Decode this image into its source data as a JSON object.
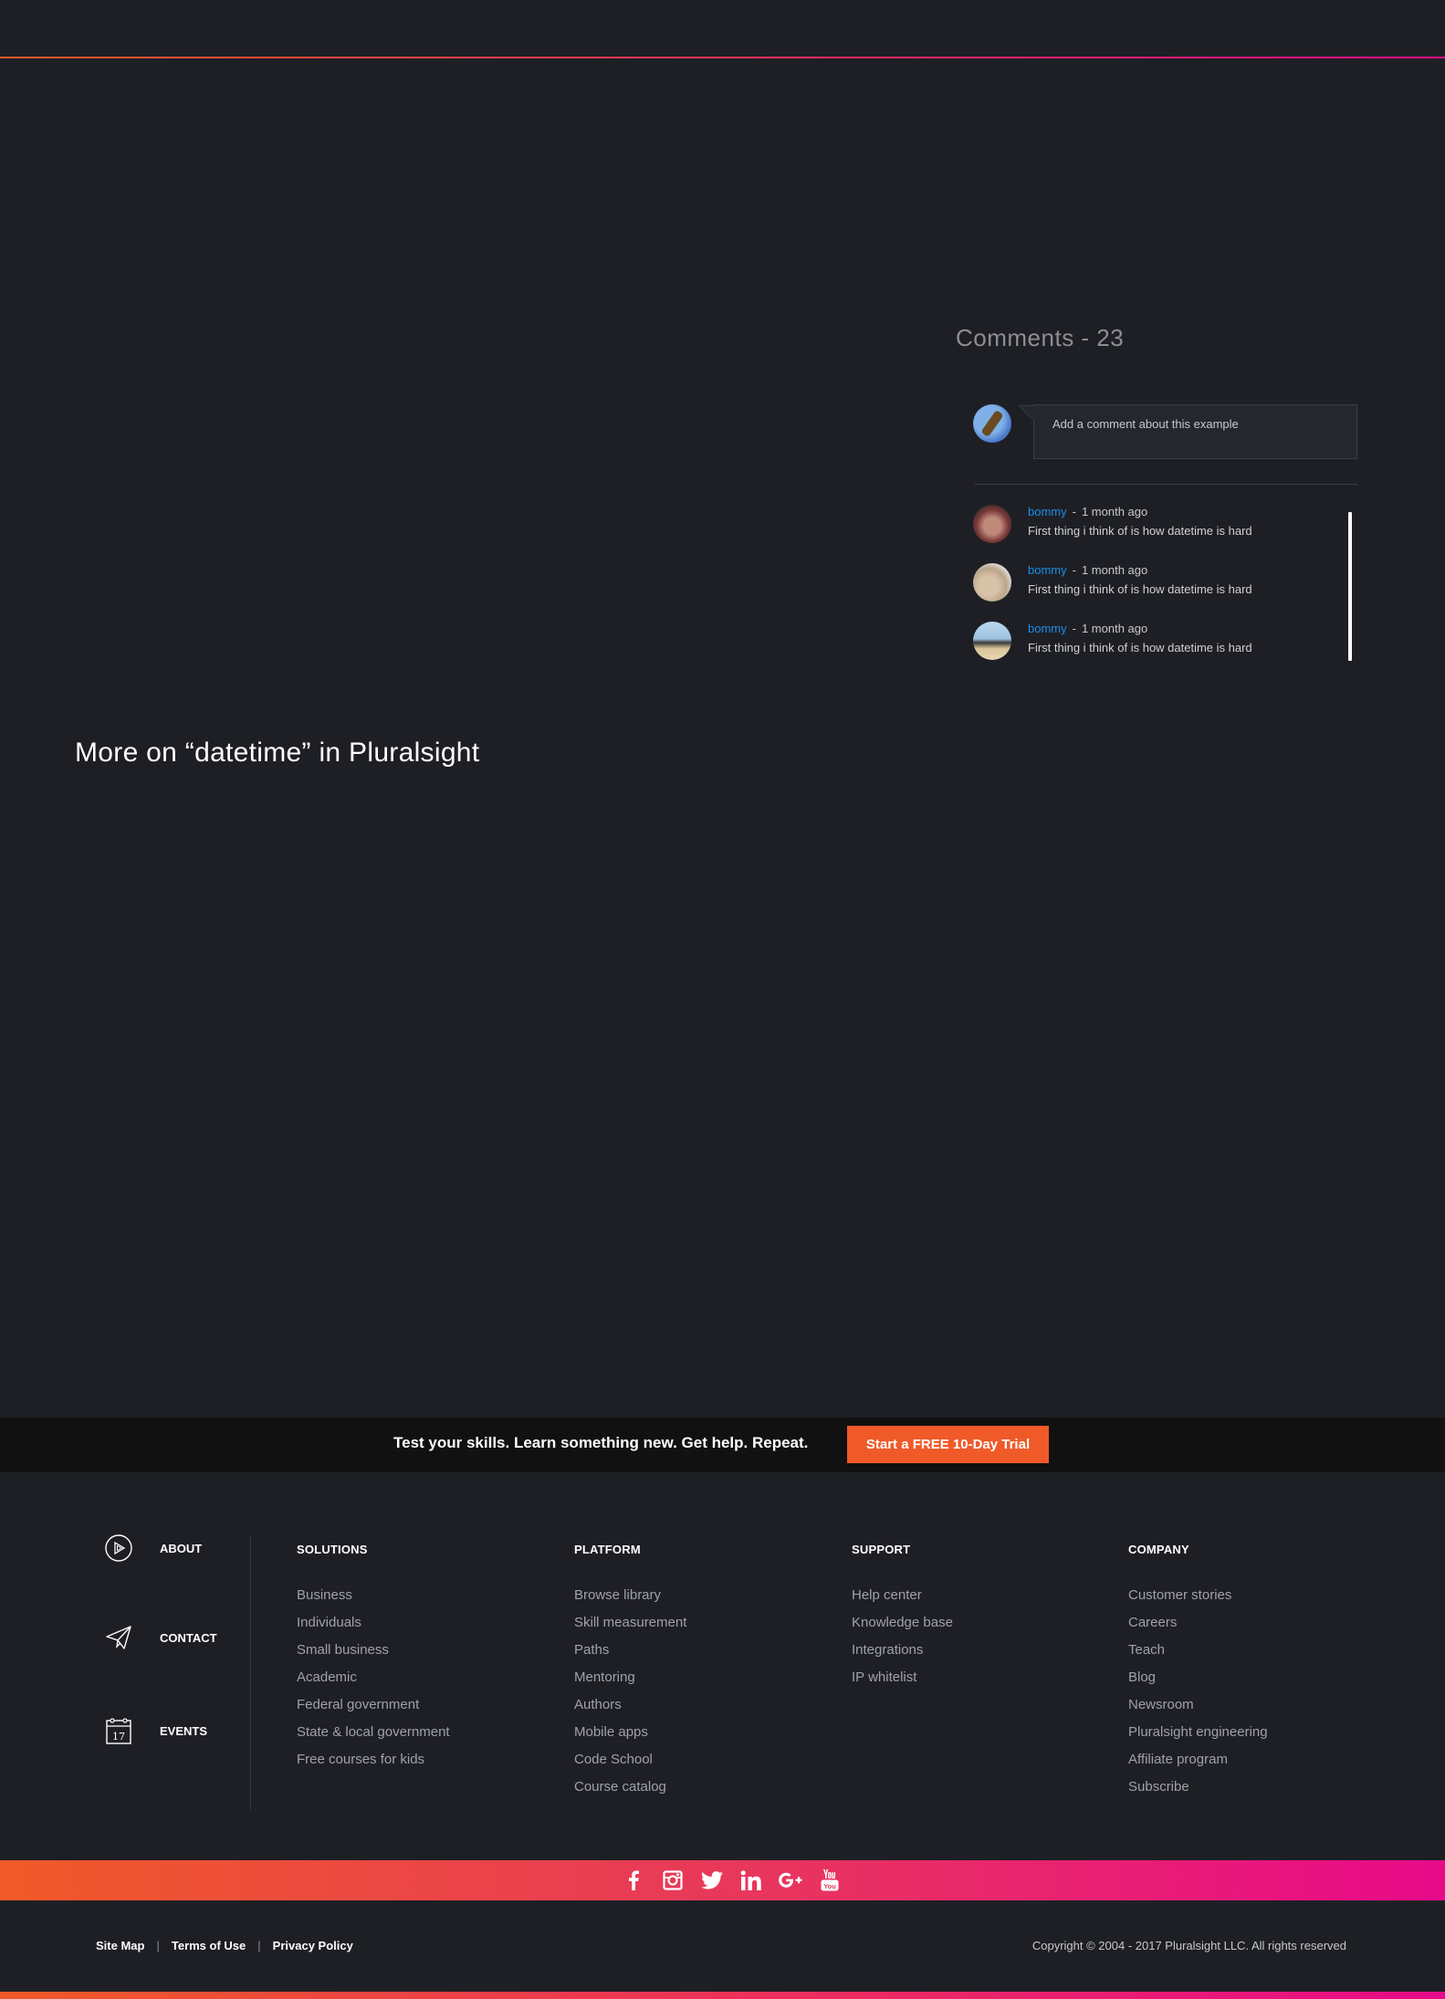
{
  "comments": {
    "title": "Comments - 23",
    "input_placeholder": "Add a comment about this example",
    "items": [
      {
        "author": "bommy",
        "separator": "-",
        "time": "1 month ago",
        "text": "First thing i think of is how datetime is hard"
      },
      {
        "author": "bommy",
        "separator": "-",
        "time": "1 month ago",
        "text": "First thing i think of is how datetime is hard"
      },
      {
        "author": "bommy",
        "separator": "-",
        "time": "1 month ago",
        "text": "First thing i think of is how datetime is hard"
      }
    ]
  },
  "more_heading": "More on “datetime” in Pluralsight",
  "cta": {
    "text": "Test your skills. Learn something new. Get help. Repeat.",
    "button": "Start a FREE 10-Day Trial"
  },
  "footer": {
    "side_links": [
      {
        "label": "ABOUT",
        "icon": "play-circle-icon"
      },
      {
        "label": "CONTACT",
        "icon": "paper-plane-icon"
      },
      {
        "label": "EVENTS",
        "icon": "calendar-icon",
        "icon_text": "17"
      }
    ],
    "columns": [
      {
        "title": "SOLUTIONS",
        "items": [
          "Business",
          "Individuals",
          "Small business",
          "Academic",
          "Federal government",
          "State & local government",
          "Free courses for kids"
        ]
      },
      {
        "title": "PLATFORM",
        "items": [
          "Browse library",
          "Skill measurement",
          "Paths",
          "Mentoring",
          "Authors",
          "Mobile apps",
          "Code School",
          "Course catalog"
        ]
      },
      {
        "title": "SUPPORT",
        "items": [
          "Help center",
          "Knowledge base",
          "Integrations",
          "IP whitelist"
        ]
      },
      {
        "title": "COMPANY",
        "items": [
          "Customer stories",
          "Careers",
          "Teach",
          "Blog",
          "Newsroom",
          "Pluralsight engineering",
          "Affiliate program",
          "Subscribe"
        ]
      }
    ]
  },
  "social": [
    "facebook-icon",
    "instagram-icon",
    "twitter-icon",
    "linkedin-icon",
    "google-plus-icon",
    "youtube-icon"
  ],
  "bottom": {
    "links": [
      "Site Map",
      "Terms of Use",
      "Privacy Policy"
    ],
    "pipe": "|",
    "copyright": "Copyright © 2004 - 2017 Pluralsight LLC. All rights reserved"
  },
  "colors": {
    "background": "#1e1f25",
    "accent_orange": "#f05a28",
    "accent_pink": "#e80a89",
    "link_blue": "#1a8ee6"
  }
}
